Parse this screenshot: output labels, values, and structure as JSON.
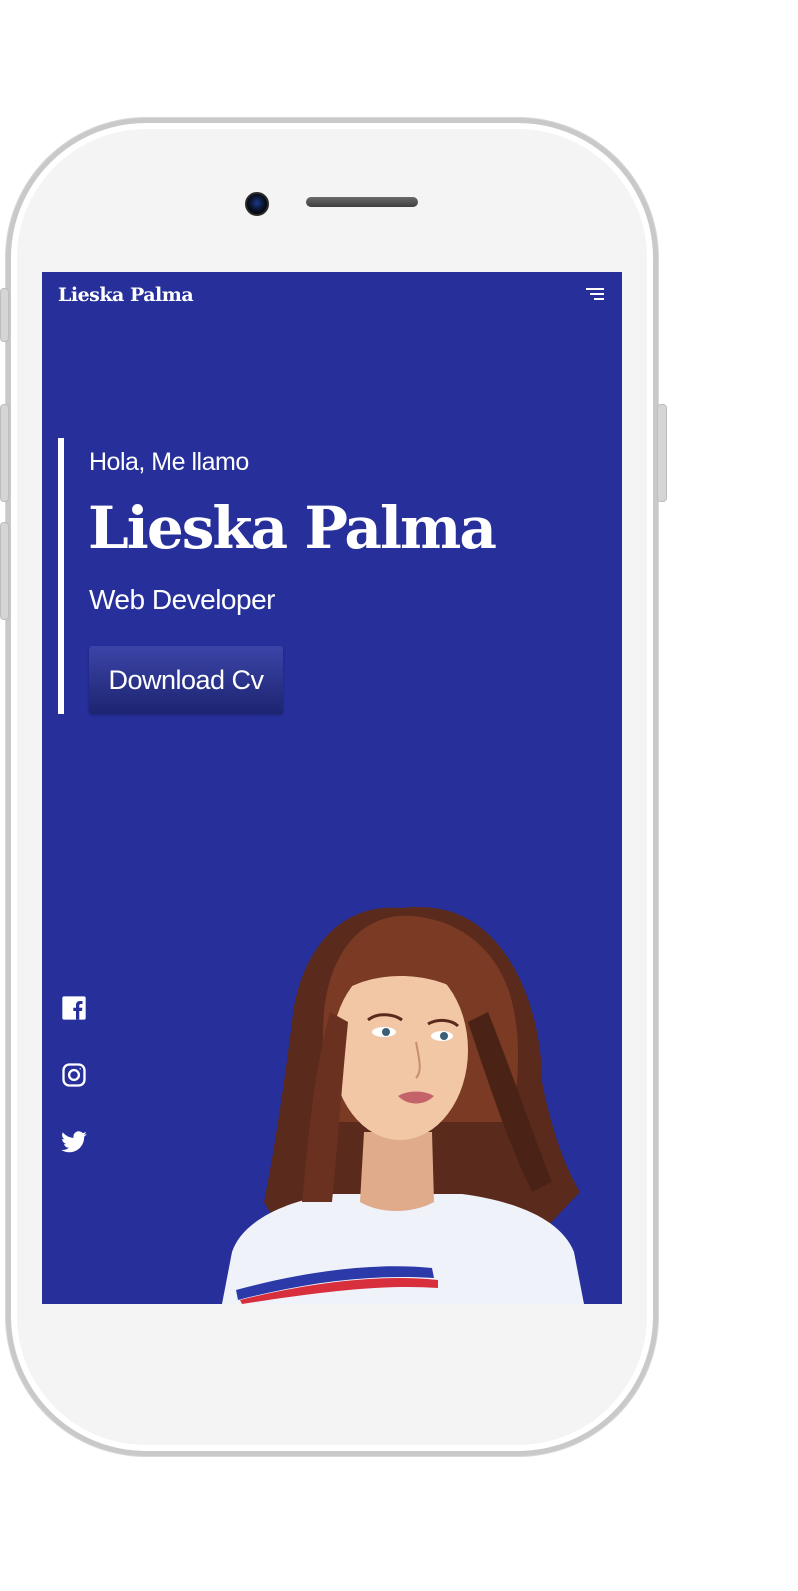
{
  "header": {
    "brand": "Lieska Palma",
    "menu_icon": "menu-lines-icon"
  },
  "hero": {
    "greeting": "Hola, Me llamo",
    "name": "Lieska Palma",
    "role": "Web Developer",
    "cta_label": "Download Cv"
  },
  "social": [
    {
      "name": "facebook",
      "icon": "facebook-icon"
    },
    {
      "name": "instagram",
      "icon": "instagram-icon"
    },
    {
      "name": "twitter",
      "icon": "twitter-icon"
    }
  ],
  "colors": {
    "screen_bg": "#262f9a",
    "button_top": "#3b45a8",
    "button_bottom": "#1d2470",
    "text": "#ffffff",
    "phone_frame": "#c9c9c9"
  }
}
